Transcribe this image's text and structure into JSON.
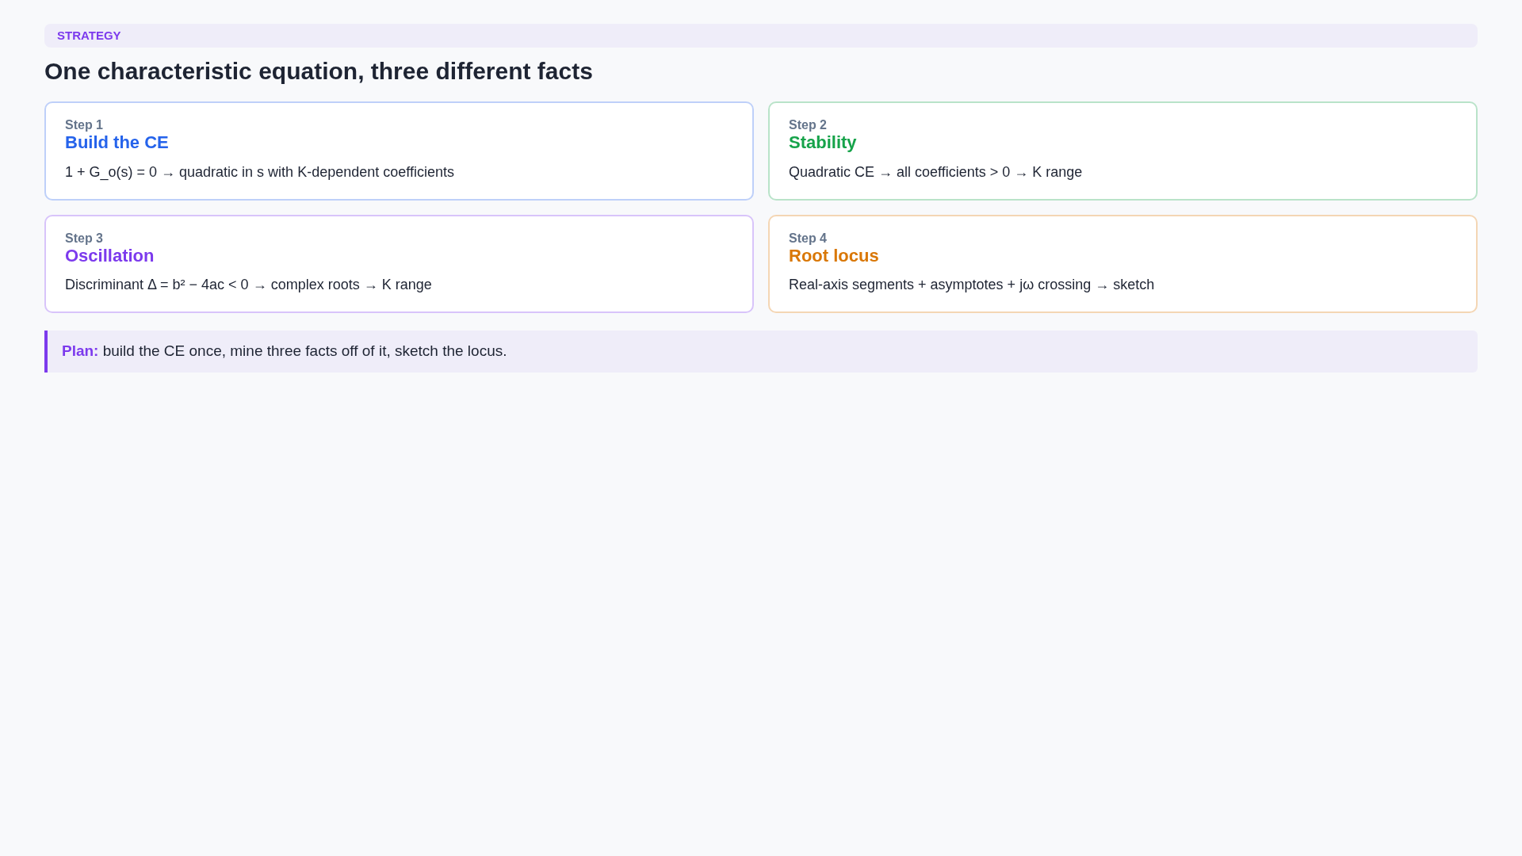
{
  "tag": "STRATEGY",
  "title": "One characteristic equation, three different facts",
  "steps": [
    {
      "step": "Step 1",
      "title": "Build the CE",
      "text": "1 + G_o(s) = 0 → quadratic in s with K-dependent coefficients",
      "color": "#2563eb"
    },
    {
      "step": "Step 2",
      "title": "Stability",
      "text": "Quadratic CE → all coefficients > 0 → K range",
      "color": "#16a34a"
    },
    {
      "step": "Step 3",
      "title": "Oscillation",
      "text": "Discriminant Δ = b² − 4ac < 0 → complex roots → K range",
      "color": "#7c3aed"
    },
    {
      "step": "Step 4",
      "title": "Root locus",
      "text": "Real-axis segments + asymptotes + jω crossing → sketch",
      "color": "#d97706"
    }
  ],
  "plan": "**Plan:** build the CE once, mine three facts off of it, sketch the locus."
}
